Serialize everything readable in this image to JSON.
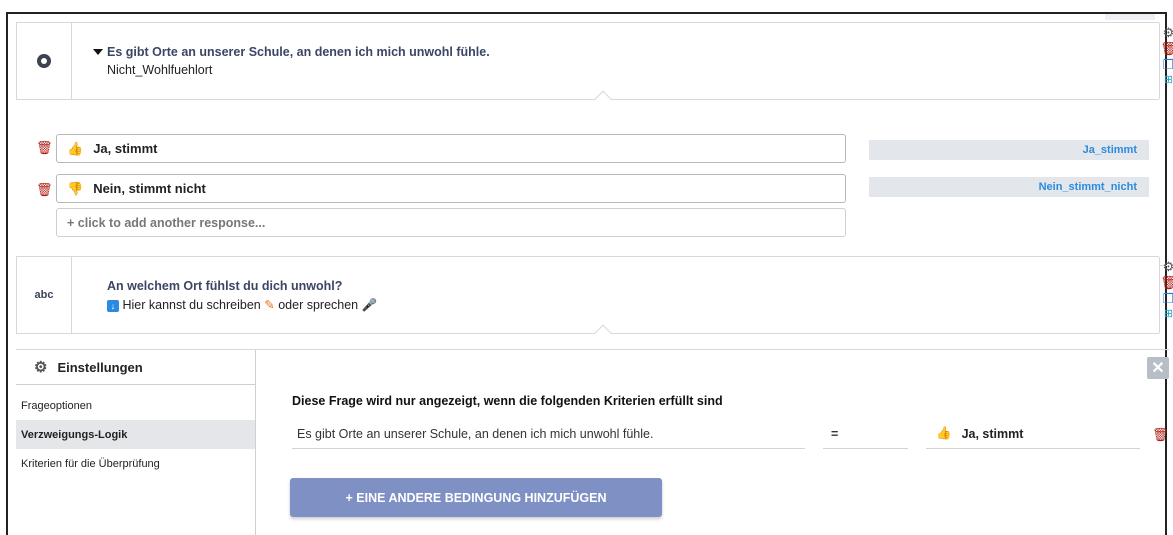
{
  "question1": {
    "type_icon": "radio-icon",
    "title": "Es gibt Orte an unserer Schule, an denen ich mich unwohl fühle.",
    "variable": "Nicht_Wohlfuehlort"
  },
  "responses": [
    {
      "emoji": "👍",
      "label": "Ja, stimmt",
      "code": "Ja_stimmt"
    },
    {
      "emoji": "👎",
      "label": "Nein, stimmt nicht",
      "code": "Nein_stimmt_nicht"
    }
  ],
  "add_response_placeholder": "+ click to add another response...",
  "question2": {
    "type_label": "abc",
    "title": "An welchem Ort fühlst du dich unwohl?",
    "hint_prefix": "Hier kannst du schreiben",
    "hint_middle": "oder sprechen"
  },
  "settings": {
    "header": "Einstellungen",
    "menu": [
      {
        "label": "Frageoptionen",
        "active": false
      },
      {
        "label": "Verzweigungs-Logik",
        "active": true
      },
      {
        "label": "Kriterien für die Überprüfung",
        "active": false
      }
    ],
    "close_label": "✕",
    "logic_heading": "Diese Frage wird nur angezeigt, wenn die folgenden Kriterien erfüllt sind",
    "condition": {
      "question": "Es gibt Orte an unserer Schule, an denen ich mich unwohl fühle.",
      "operator": "=",
      "value_emoji": "👍",
      "value": "Ja, stimmt"
    },
    "add_condition_label": "+ EINE ANDERE BEDINGUNG HINZUFÜGEN"
  },
  "colors": {
    "accent_button": "#7e90c4",
    "delete": "#b01a12",
    "code_text": "#2a8be0",
    "copy_icon": "#1a84e6"
  }
}
